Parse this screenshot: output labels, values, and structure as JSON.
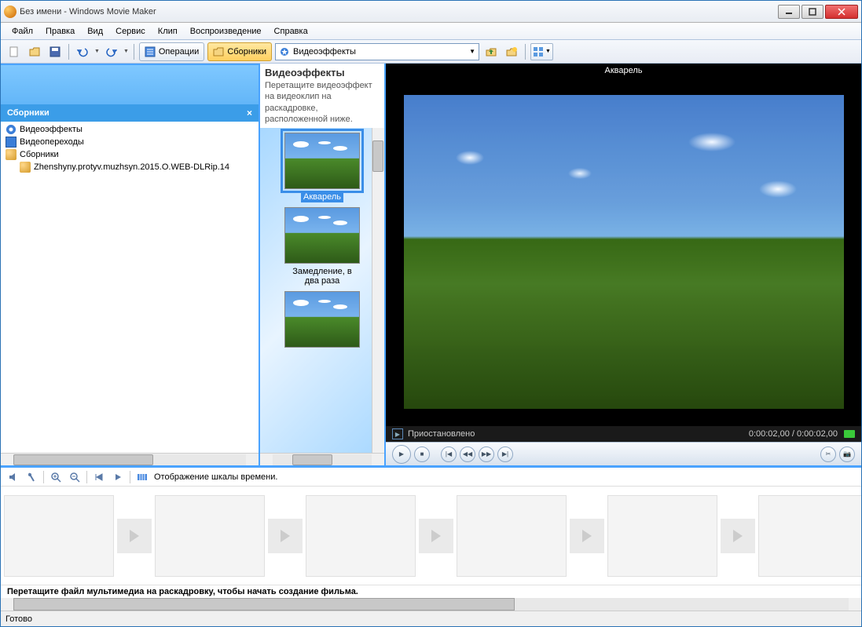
{
  "window": {
    "title": "Без имени - Windows Movie Maker"
  },
  "menu": {
    "file": "Файл",
    "edit": "Правка",
    "view": "Вид",
    "tools": "Сервис",
    "clip": "Клип",
    "play": "Воспроизведение",
    "help": "Справка"
  },
  "toolbar": {
    "tasks": "Операции",
    "collections": "Сборники",
    "combo_value": "Видеоэффекты"
  },
  "collections": {
    "header": "Сборники",
    "items": {
      "effects": "Видеоэффекты",
      "transitions": "Видеопереходы",
      "collections": "Сборники",
      "file1": "Zhenshyny.protyv.muzhsyn.2015.O.WEB-DLRip.14"
    }
  },
  "effects": {
    "title": "Видеоэффекты",
    "hint": "Перетащите видеоэффект на видеоклип на раскадровке, расположенной ниже.",
    "item1": "Акварель",
    "item2": "Замедление, в два раза"
  },
  "preview": {
    "title": "Акварель",
    "status": "Приостановлено",
    "time": "0:00:02,00 / 0:00:02,00"
  },
  "storyboard": {
    "toolbar_hint": "Отображение шкалы времени.",
    "drag_hint": "Перетащите файл мультимедиа на раскадровку, чтобы начать создание фильма."
  },
  "status": {
    "text": "Готово"
  }
}
